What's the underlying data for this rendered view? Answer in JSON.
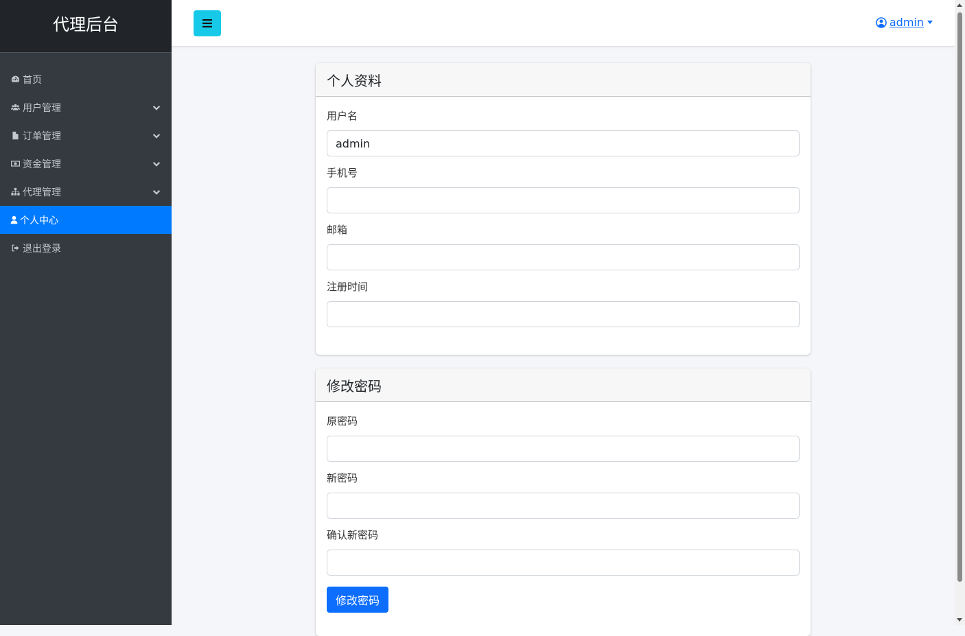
{
  "sidebar": {
    "brand": "代理后台",
    "items": [
      {
        "label": "首页",
        "icon": "dashboard-icon",
        "expandable": false,
        "active": false
      },
      {
        "label": "用户管理",
        "icon": "users-icon",
        "expandable": true,
        "active": false
      },
      {
        "label": "订单管理",
        "icon": "file-icon",
        "expandable": true,
        "active": false
      },
      {
        "label": "资金管理",
        "icon": "money-icon",
        "expandable": true,
        "active": false
      },
      {
        "label": "代理管理",
        "icon": "sitemap-icon",
        "expandable": true,
        "active": false
      },
      {
        "label": "个人中心",
        "icon": "user-icon",
        "expandable": false,
        "active": true
      },
      {
        "label": "退出登录",
        "icon": "sign-out-icon",
        "expandable": false,
        "active": false
      }
    ]
  },
  "topbar": {
    "menu_icon": "bars-icon",
    "user_label": " admin",
    "user_icon": "user-circle-icon"
  },
  "profile": {
    "title": "个人资料",
    "fields": [
      {
        "label": "用户名",
        "value": "admin"
      },
      {
        "label": "手机号",
        "value": ""
      },
      {
        "label": "邮箱",
        "value": ""
      },
      {
        "label": "注册时间",
        "value": ""
      }
    ]
  },
  "password": {
    "title": "修改密码",
    "fields": [
      {
        "label": "原密码",
        "value": ""
      },
      {
        "label": "新密码",
        "value": ""
      },
      {
        "label": "确认新密码",
        "value": ""
      }
    ],
    "submit_label": "修改密码"
  },
  "colors": {
    "sidebar_bg": "#343a40",
    "brand_bg": "#212529",
    "active": "#007bff",
    "menu_button": "#17c9e8",
    "primary": "#0d6efd"
  }
}
